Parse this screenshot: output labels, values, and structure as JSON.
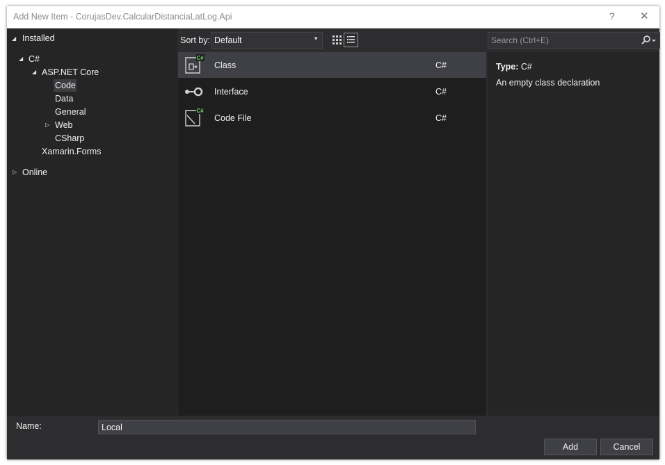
{
  "window": {
    "title": "Add New Item - CorujasDev.CalcularDistanciaLatLog.Api",
    "help": "?",
    "close": "✕"
  },
  "tree": {
    "installed": "Installed",
    "csharp": "C#",
    "aspnetcore": "ASP.NET Core",
    "code": "Code",
    "data": "Data",
    "general": "General",
    "web": "Web",
    "csharp_sub": "CSharp",
    "xamarin": "Xamarin.Forms",
    "online": "Online"
  },
  "sort": {
    "label": "Sort by:",
    "value": "Default"
  },
  "search": {
    "placeholder": "Search (Ctrl+E)"
  },
  "templates": [
    {
      "name": "Class",
      "lang": "C#",
      "icon": "class-icon",
      "selected": true
    },
    {
      "name": "Interface",
      "lang": "C#",
      "icon": "interface-icon",
      "selected": false
    },
    {
      "name": "Code File",
      "lang": "C#",
      "icon": "code-file-icon",
      "selected": false
    }
  ],
  "details": {
    "type_label": "Type:",
    "type_value": "C#",
    "description": "An empty class declaration"
  },
  "footer": {
    "name_label": "Name:",
    "name_value": "Local",
    "add": "Add",
    "cancel": "Cancel"
  },
  "colors": {
    "dialog_bg": "#2d2d30",
    "panel_bg": "#252526",
    "list_bg": "#1e1e1e",
    "selected_row": "#3f3f46",
    "csharp_badge": "#6ad26a"
  }
}
